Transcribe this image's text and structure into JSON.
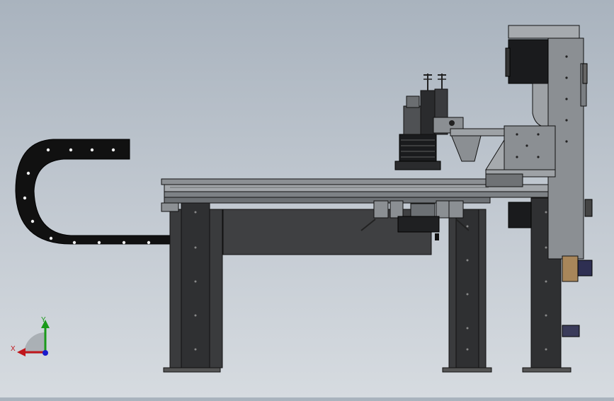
{
  "viewport": {
    "background_top": "#a9b3be",
    "background_bottom": "#d6dbe0",
    "model_color_dark": "#2e2e30",
    "model_color_mid": "#6f7275",
    "model_color_light": "#9ea2a6",
    "edge_color": "#1a1a1a"
  },
  "triad": {
    "x_label": "X",
    "y_label": "Y",
    "x_color": "#c0161c",
    "y_color": "#1a9a1a",
    "z_color": "#1a1acc"
  }
}
